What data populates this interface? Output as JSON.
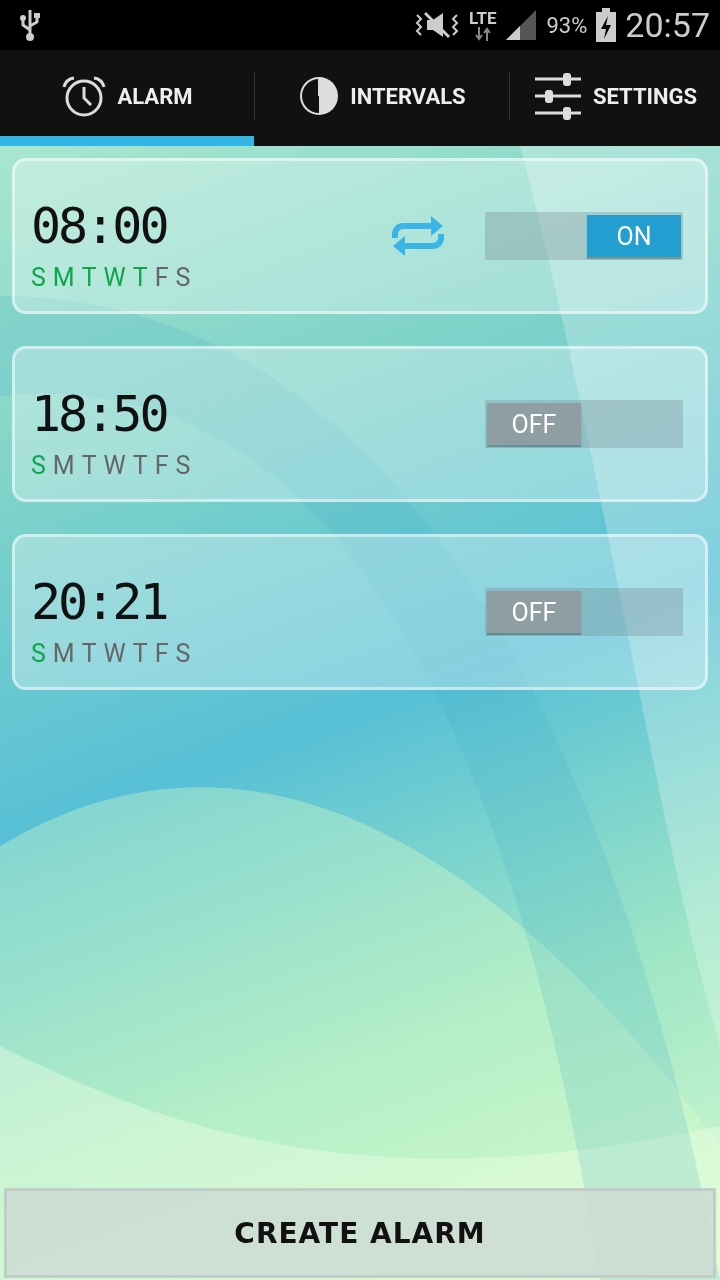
{
  "status_bar": {
    "network": "LTE",
    "battery": "93%",
    "time": "20:57"
  },
  "tabs": [
    {
      "label": "ALARM",
      "selected": true,
      "kind": "alarm"
    },
    {
      "label": "INTERVALS",
      "selected": false,
      "kind": "intervals"
    },
    {
      "label": "SETTINGS",
      "selected": false,
      "kind": "settings"
    }
  ],
  "alarms": [
    {
      "time": "08:00",
      "repeat": true,
      "on": true,
      "toggle_label": "ON",
      "days": [
        {
          "label": "S",
          "on": true
        },
        {
          "label": "M",
          "on": true
        },
        {
          "label": "T",
          "on": true
        },
        {
          "label": "W",
          "on": true
        },
        {
          "label": "T",
          "on": true
        },
        {
          "label": "F",
          "on": false
        },
        {
          "label": "S",
          "on": false
        }
      ]
    },
    {
      "time": "18:50",
      "repeat": false,
      "on": false,
      "toggle_label": "OFF",
      "days": [
        {
          "label": "S",
          "on": true
        },
        {
          "label": "M",
          "on": false
        },
        {
          "label": "T",
          "on": false
        },
        {
          "label": "W",
          "on": false
        },
        {
          "label": "T",
          "on": false
        },
        {
          "label": "F",
          "on": false
        },
        {
          "label": "S",
          "on": false
        }
      ]
    },
    {
      "time": "20:21",
      "repeat": false,
      "on": false,
      "toggle_label": "OFF",
      "days": [
        {
          "label": "S",
          "on": true
        },
        {
          "label": "M",
          "on": false
        },
        {
          "label": "T",
          "on": false
        },
        {
          "label": "W",
          "on": false
        },
        {
          "label": "T",
          "on": false
        },
        {
          "label": "F",
          "on": false
        },
        {
          "label": "S",
          "on": false
        }
      ]
    }
  ],
  "create_button": "CREATE ALARM"
}
